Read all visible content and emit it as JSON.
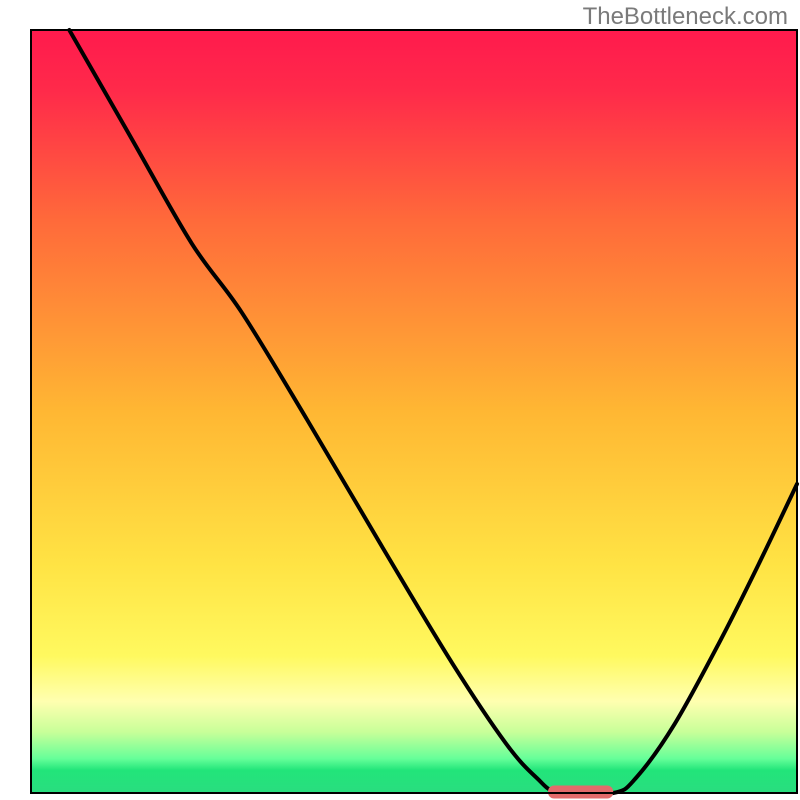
{
  "attribution": "TheBottleneck.com",
  "chart_data": {
    "type": "line",
    "title": "",
    "xlabel": "",
    "ylabel": "",
    "xlim": [
      0,
      100
    ],
    "ylim": [
      0,
      100
    ],
    "grid": false,
    "legend": false,
    "background_gradient_stops": [
      {
        "offset": 0.0,
        "color": "#ff1a4d"
      },
      {
        "offset": 0.08,
        "color": "#ff2a4a"
      },
      {
        "offset": 0.25,
        "color": "#ff6a3a"
      },
      {
        "offset": 0.5,
        "color": "#ffb733"
      },
      {
        "offset": 0.7,
        "color": "#ffe344"
      },
      {
        "offset": 0.82,
        "color": "#fff95f"
      },
      {
        "offset": 0.88,
        "color": "#ffffb0"
      },
      {
        "offset": 0.92,
        "color": "#c8ff99"
      },
      {
        "offset": 0.955,
        "color": "#66ff99"
      },
      {
        "offset": 0.97,
        "color": "#22e57a"
      },
      {
        "offset": 1.0,
        "color": "#29dd7f"
      }
    ],
    "curve_points": [
      {
        "x": 5.0,
        "y": 100.0
      },
      {
        "x": 13.0,
        "y": 86.0
      },
      {
        "x": 21.0,
        "y": 72.0
      },
      {
        "x": 27.5,
        "y": 63.0
      },
      {
        "x": 36.0,
        "y": 49.0
      },
      {
        "x": 46.0,
        "y": 32.0
      },
      {
        "x": 55.0,
        "y": 17.0
      },
      {
        "x": 62.0,
        "y": 6.5
      },
      {
        "x": 66.0,
        "y": 2.0
      },
      {
        "x": 69.0,
        "y": 0.0
      },
      {
        "x": 76.0,
        "y": 0.0
      },
      {
        "x": 79.0,
        "y": 2.0
      },
      {
        "x": 84.0,
        "y": 9.0
      },
      {
        "x": 90.0,
        "y": 20.0
      },
      {
        "x": 95.0,
        "y": 30.0
      },
      {
        "x": 100.0,
        "y": 40.5
      }
    ],
    "optimal_marker": {
      "x_start": 67.5,
      "x_end": 76.0,
      "y": 0.0,
      "color": "#e26b6b"
    },
    "frame": {
      "x0": 5,
      "y0": 3,
      "x1": 100,
      "y1": 100,
      "stroke": "#000000",
      "stroke_width": 2
    }
  }
}
